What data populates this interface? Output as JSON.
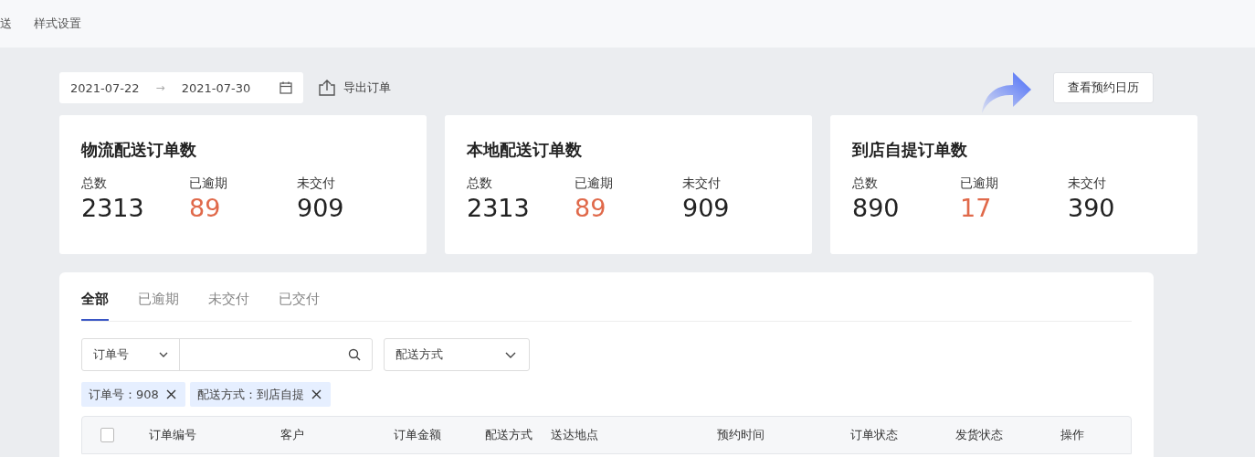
{
  "top_nav": [
    {
      "label": "送",
      "selected": false
    },
    {
      "label": "样式设置",
      "selected": false
    }
  ],
  "toolbar": {
    "date_start": "2021-07-22",
    "date_separator": "→",
    "date_end": "2021-07-30",
    "export_label": "导出订单",
    "calendar_button": "查看预约日历"
  },
  "stat_cards": [
    {
      "title": "物流配送订单数",
      "stats": [
        {
          "label": "总数",
          "value": "2313",
          "kind": "normal"
        },
        {
          "label": "已逾期",
          "value": "89",
          "kind": "warning"
        },
        {
          "label": "未交付",
          "value": "909",
          "kind": "normal"
        }
      ]
    },
    {
      "title": "本地配送订单数",
      "stats": [
        {
          "label": "总数",
          "value": "2313",
          "kind": "normal"
        },
        {
          "label": "已逾期",
          "value": "89",
          "kind": "warning"
        },
        {
          "label": "未交付",
          "value": "909",
          "kind": "normal"
        }
      ]
    },
    {
      "title": "到店自提订单数",
      "stats": [
        {
          "label": "总数",
          "value": "890",
          "kind": "normal"
        },
        {
          "label": "已逾期",
          "value": "17",
          "kind": "warning"
        },
        {
          "label": "未交付",
          "value": "390",
          "kind": "normal"
        }
      ]
    }
  ],
  "tabs": [
    {
      "label": "全部",
      "selected": true
    },
    {
      "label": "已逾期",
      "selected": false
    },
    {
      "label": "未交付",
      "selected": false
    },
    {
      "label": "已交付",
      "selected": false
    }
  ],
  "filters": {
    "search_type": "订单号",
    "delivery_select": "配送方式"
  },
  "active_filters": [
    {
      "label": "订单号：908"
    },
    {
      "label": "配送方式：到店自提"
    }
  ],
  "table": {
    "select_all_checked": false,
    "columns": [
      "订单编号",
      "客户",
      "订单金额",
      "配送方式",
      "送达地点",
      "预约时间",
      "订单状态",
      "发货状态",
      "操作"
    ]
  }
}
